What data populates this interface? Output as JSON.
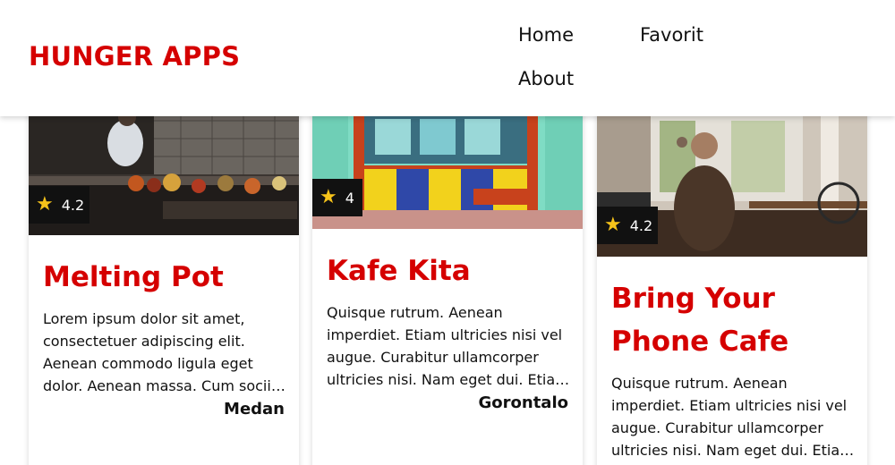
{
  "header": {
    "brand": "HUNGER APPS",
    "nav": [
      {
        "label": "Home"
      },
      {
        "label": "Favorit"
      },
      {
        "label": "About"
      }
    ]
  },
  "restaurants": [
    {
      "name": "Melting Pot",
      "rating": "4.2",
      "description": "Lorem ipsum dolor sit amet, consectetuer adipiscing elit. Aenean commodo ligula eget dolor. Aenean massa. Cum sociis natoque penatibus et magnis dis parturient montes",
      "city": "Medan"
    },
    {
      "name": "Kafe Kita",
      "rating": "4",
      "description": "Quisque rutrum. Aenean imperdiet. Etiam ultricies nisi vel augue. Curabitur ullamcorper ultricies nisi. Nam eget dui. Etiam rhoncus. Maecenas tempus, tellus eget condimentum",
      "city": "Gorontalo"
    },
    {
      "name": "Bring Your Phone Cafe",
      "rating": "4.2",
      "description": "Quisque rutrum. Aenean imperdiet. Etiam ultricies nisi vel augue. Curabitur ullamcorper ultricies nisi. Nam eget dui. Etiam rhoncus. Maecenas tempus, tellus eget condimentum",
      "city": ""
    }
  ],
  "colors": {
    "brand": "#d50000",
    "rating_bg": "#111111",
    "star": "#f6c31a"
  },
  "icons": {
    "rating": "star-icon"
  }
}
